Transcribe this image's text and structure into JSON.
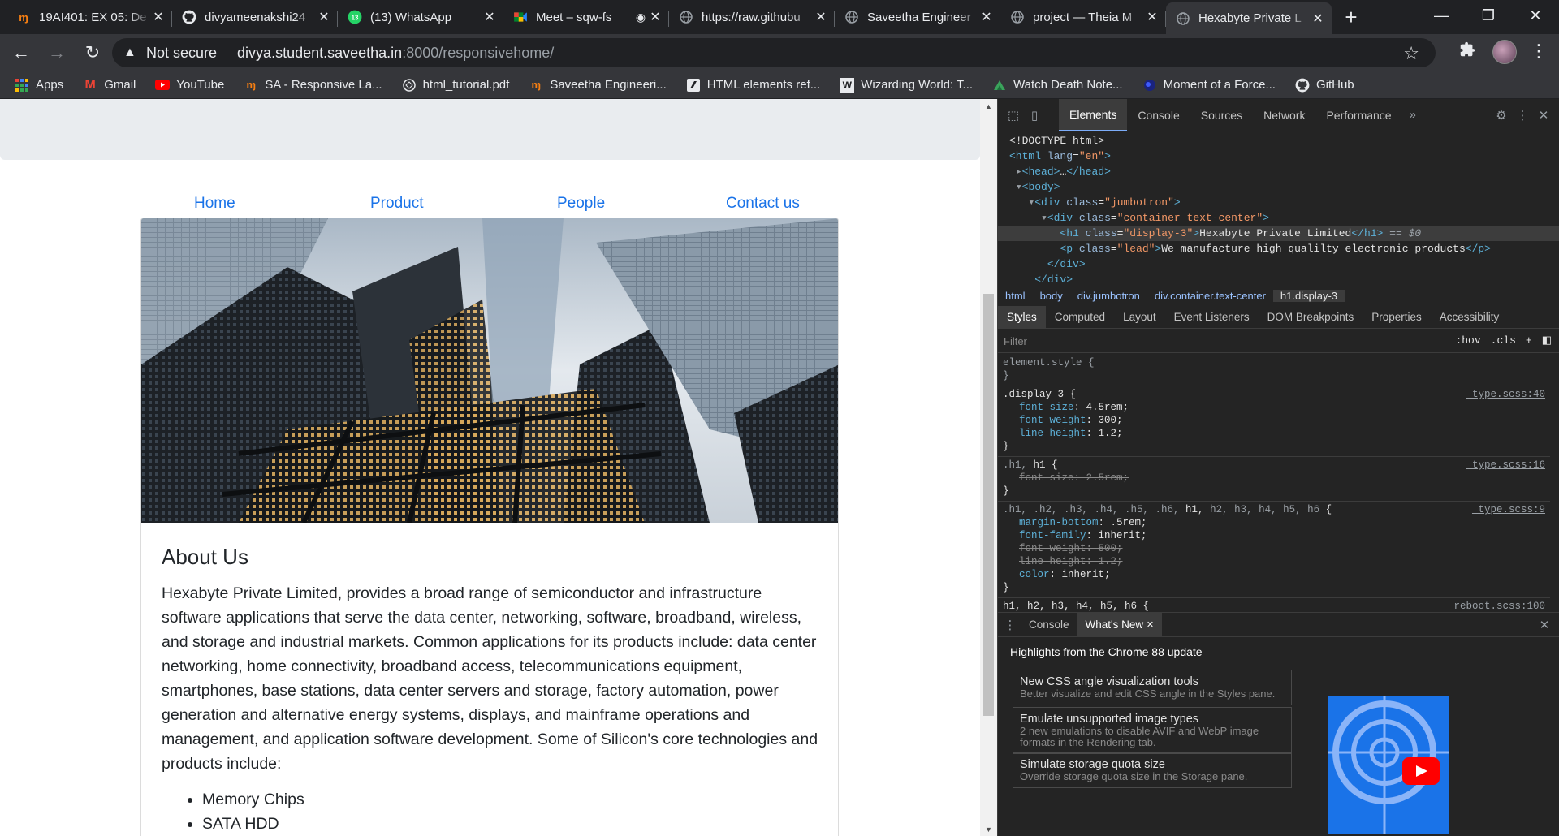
{
  "browser": {
    "tabs": [
      {
        "title": "19AI401: EX 05: De",
        "icon": "moodle-icon"
      },
      {
        "title": "divyameenakshi24",
        "icon": "github-icon"
      },
      {
        "title": "(13) WhatsApp",
        "icon": "whatsapp-icon"
      },
      {
        "title": "Meet – sqw-fs",
        "icon": "meet-icon"
      },
      {
        "title": "https://raw.githubu",
        "icon": "globe-icon"
      },
      {
        "title": "Saveetha Engineer",
        "icon": "globe-icon"
      },
      {
        "title": "project — Theia M",
        "icon": "globe-icon"
      },
      {
        "title": "Hexabyte Private L",
        "icon": "globe-icon"
      }
    ],
    "not_secure": "Not secure",
    "url_host": "divya.student.saveetha.in",
    "url_rest": ":8000/responsivehome/",
    "bookmarks": [
      {
        "label": "Apps",
        "icon": "apps-grid-icon",
        "color": "#e8eaed"
      },
      {
        "label": "Gmail",
        "icon": "gmail-icon",
        "color": "#ea4335"
      },
      {
        "label": "YouTube",
        "icon": "youtube-icon",
        "color": "#ff0000"
      },
      {
        "label": "SA - Responsive La...",
        "icon": "moodle-icon",
        "color": "#f98012"
      },
      {
        "label": "html_tutorial.pdf",
        "icon": "pdf-icon",
        "color": "#e8eaed"
      },
      {
        "label": "Saveetha Engineeri...",
        "icon": "moodle-icon",
        "color": "#f98012"
      },
      {
        "label": "HTML elements ref...",
        "icon": "mdn-icon",
        "color": "#e8eaed"
      },
      {
        "label": "Wizarding World: T...",
        "icon": "w-icon",
        "color": "#e8eaed"
      },
      {
        "label": "Watch Death Note...",
        "icon": "arrow-icon",
        "color": "#36c"
      },
      {
        "label": "Moment of a Force...",
        "icon": "dot-icon",
        "color": "#3d5afe"
      },
      {
        "label": "GitHub",
        "icon": "github-icon",
        "color": "#e8eaed"
      }
    ]
  },
  "page": {
    "nav": [
      "Home",
      "Product",
      "People",
      "Contact us"
    ],
    "about_title": "About Us",
    "about_text": "Hexabyte Private Limited, provides a broad range of semiconductor and infrastructure software applications that serve the data center, networking, software, broadband, wireless, and storage and industrial markets. Common applications for its products include: data center networking, home connectivity, broadband access, telecommunications equipment, smartphones, base stations, data center servers and storage, factory automation, power generation and alternative energy systems, displays, and mainframe operations and management, and application software development. Some of Silicon's core technologies and products include:",
    "list": [
      "Memory Chips",
      "SATA HDD"
    ],
    "link_color": "#1a73e8"
  },
  "devtools": {
    "tabs": [
      "Elements",
      "Console",
      "Sources",
      "Network",
      "Performance"
    ],
    "crumbs": [
      "html",
      "body",
      "div.jumbotron",
      "div.container.text-center",
      "h1.display-3"
    ],
    "subtabs": [
      "Styles",
      "Computed",
      "Layout",
      "Event Listeners",
      "DOM Breakpoints",
      "Properties",
      "Accessibility"
    ],
    "filter_placeholder": "Filter",
    "hov": ":hov",
    "cls": ".cls",
    "drawer_tabs": [
      "Console",
      "What's New"
    ],
    "whats_new_title": "Highlights from the Chrome 88 update",
    "whats_new": [
      {
        "head": "New CSS angle visualization tools",
        "desc": "Better visualize and edit CSS angle in the Styles pane."
      },
      {
        "head": "Emulate unsupported image types",
        "desc": "2 new emulations to disable AVIF and WebP image formats in the Rendering tab."
      },
      {
        "head": "Simulate storage quota size",
        "desc": "Override storage quota size in the Storage pane."
      }
    ]
  }
}
